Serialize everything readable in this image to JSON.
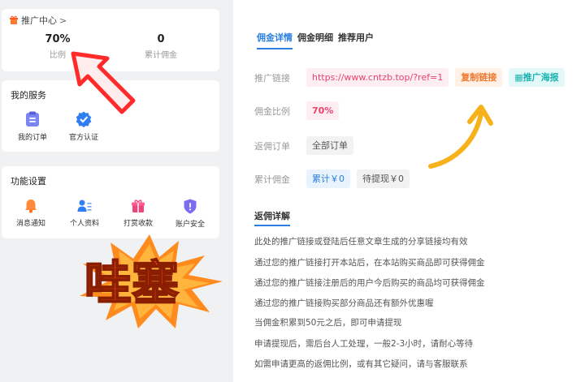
{
  "promo": {
    "title": "推广中心",
    "chevron": ">",
    "stats": [
      {
        "value": "70%",
        "label": "比例"
      },
      {
        "value": "0",
        "label": "累计佣金"
      }
    ]
  },
  "services": {
    "title": "我的服务",
    "items": [
      {
        "label": "我的订单",
        "icon": "order-icon"
      },
      {
        "label": "官方认证",
        "icon": "verified-icon"
      }
    ]
  },
  "settings": {
    "title": "功能设置",
    "items": [
      {
        "label": "消息通知",
        "icon": "bell-icon"
      },
      {
        "label": "个人资料",
        "icon": "profile-icon"
      },
      {
        "label": "打赏收款",
        "icon": "gift-icon"
      },
      {
        "label": "账户安全",
        "icon": "shield-icon"
      }
    ]
  },
  "sticker": {
    "text": "哇塞"
  },
  "tabs": [
    {
      "label": "佣金详情",
      "active": true
    },
    {
      "label": "佣金明细",
      "active": false
    },
    {
      "label": "推荐用户",
      "active": false
    }
  ],
  "fields": {
    "link": {
      "label": "推广链接",
      "url": "https://www.cntzb.top/?ref=1",
      "copy_label": "复制链接",
      "poster_label": "推广海报"
    },
    "ratio": {
      "label": "佣金比例",
      "value": "70%"
    },
    "orders": {
      "label": "返佣订单",
      "value": "全部订单"
    },
    "total": {
      "label": "累计佣金",
      "accum": "累计￥0",
      "pending": "待提现￥0"
    }
  },
  "detail": {
    "title": "返佣详解",
    "lines": [
      "此处的推广链接或登陆后任意文章生成的分享链接均有效",
      "通过您的推广链接打开本站后，在本站购买商品即可获得佣金",
      "通过您的推广链接注册后的用户今后购买的商品均可获得佣金",
      "通过您的推广链接购买部分商品还有额外优惠喔",
      "当佣金积累到50元之后，即可申请提现",
      "申请提现后，需后台人工处理，一般2-3小时，请耐心等待",
      "如需申请更高的返佣比例，或有其它疑问，请与客服联系"
    ]
  },
  "colors": {
    "accent": "#2a7fe0",
    "pink": "#e8436d",
    "orange": "#f0782c",
    "cyan": "#1ab3b3",
    "yellow_arrow": "#f7b21b",
    "red_arrow": "#ff2b2b"
  }
}
